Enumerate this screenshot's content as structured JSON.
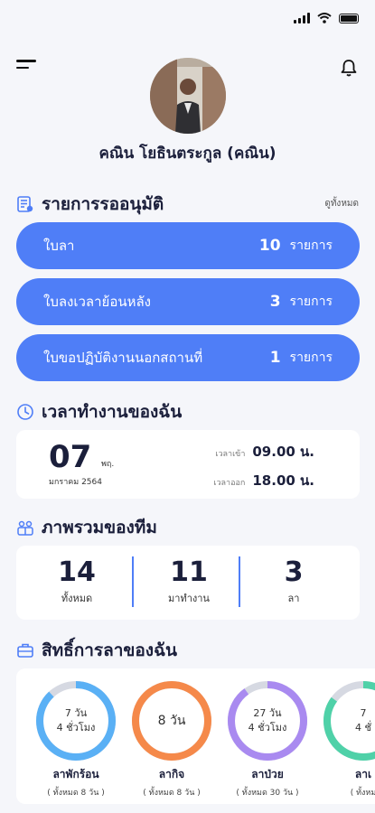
{
  "user": {
    "name": "คณิน โยธินตระกูล (คณิน)"
  },
  "approvals": {
    "title": "รายการรออนุมัติ",
    "view_all": "ดูทั้งหมด",
    "items": [
      {
        "label": "ใบลา",
        "count": "10",
        "unit": "รายการ"
      },
      {
        "label": "ใบลงเวลาย้อนหลัง",
        "count": "3",
        "unit": "รายการ"
      },
      {
        "label": "ใบขอปฏิบัติงานนอกสถานที่",
        "count": "1",
        "unit": "รายการ"
      }
    ]
  },
  "work_time": {
    "title": "เวลาทำงานของฉัน",
    "day": "07",
    "month_short": "พฤ.",
    "month_year": "มกราคม 2564",
    "in_label": "เวลาเข้า",
    "in_time": "09.00 น.",
    "out_label": "เวลาออก",
    "out_time": "18.00 น."
  },
  "team": {
    "title": "ภาพรวมของทีม",
    "stats": [
      {
        "value": "14",
        "label": "ทั้งหมด"
      },
      {
        "value": "11",
        "label": "มาทำงาน"
      },
      {
        "value": "3",
        "label": "ลา"
      }
    ]
  },
  "leave_rights": {
    "title": "สิทธิ์การลาของฉัน",
    "items": [
      {
        "line1": "7 วัน",
        "line2": "4 ชั่วโมง",
        "name": "ลาพักร้อน",
        "total": "( ทั้งหมด 8 วัน )",
        "color": "#5ab0f5",
        "progress": 0.88
      },
      {
        "line1": "8 วัน",
        "line2": "",
        "name": "ลากิจ",
        "total": "( ทั้งหมด 8 วัน )",
        "color": "#f5894a",
        "progress": 1.0
      },
      {
        "line1": "27 วัน",
        "line2": "4 ชั่วโมง",
        "name": "ลาป่วย",
        "total": "( ทั้งหมด 30 วัน )",
        "color": "#a98af0",
        "progress": 0.9
      },
      {
        "line1": "7",
        "line2": "4 ชั่",
        "name": "ลาเ",
        "total": "( ทั้งหม",
        "color": "#4fd1a8",
        "progress": 0.85
      }
    ]
  },
  "icons": {
    "menu": "menu-icon",
    "bell": "bell-icon",
    "approvals": "document-list-icon",
    "clock": "clock-icon",
    "team": "team-icon",
    "leave": "briefcase-icon"
  },
  "colors": {
    "accent": "#4f7ef7",
    "background": "#f5f6fa",
    "text": "#1b1f3b"
  }
}
